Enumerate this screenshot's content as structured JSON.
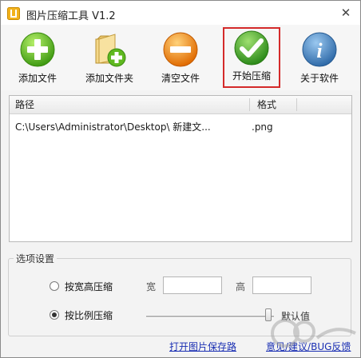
{
  "window": {
    "title": "图片压缩工具 V1.2",
    "close_glyph": "✕"
  },
  "toolbar": {
    "add_file": "添加文件",
    "add_folder": "添加文件夹",
    "clear_files": "清空文件",
    "start_compress": "开始压缩",
    "about": "关于软件"
  },
  "list": {
    "columns": [
      "路径",
      "格式"
    ],
    "rows": [
      {
        "path": "C:\\Users\\Administrator\\Desktop\\ 新建文...",
        "format": ".png"
      }
    ]
  },
  "options": {
    "legend": "选项设置",
    "mode_size": {
      "label": "按宽高压缩",
      "selected": false
    },
    "mode_ratio": {
      "label": "按比例压缩",
      "selected": true
    },
    "width_label": "宽",
    "height_label": "高",
    "width_value": "",
    "height_value": "",
    "default_label": "默认值"
  },
  "footer": {
    "open_dir_link": "打开图片保存路",
    "feedback_link": "意见/建议/BUG反馈"
  },
  "colors": {
    "highlight_border": "#d42a2a",
    "link": "#1a2fb3"
  },
  "icons": [
    "app-icon",
    "plus-circle-icon",
    "folder-plus-icon",
    "minus-circle-icon",
    "check-circle-icon",
    "info-icon"
  ]
}
